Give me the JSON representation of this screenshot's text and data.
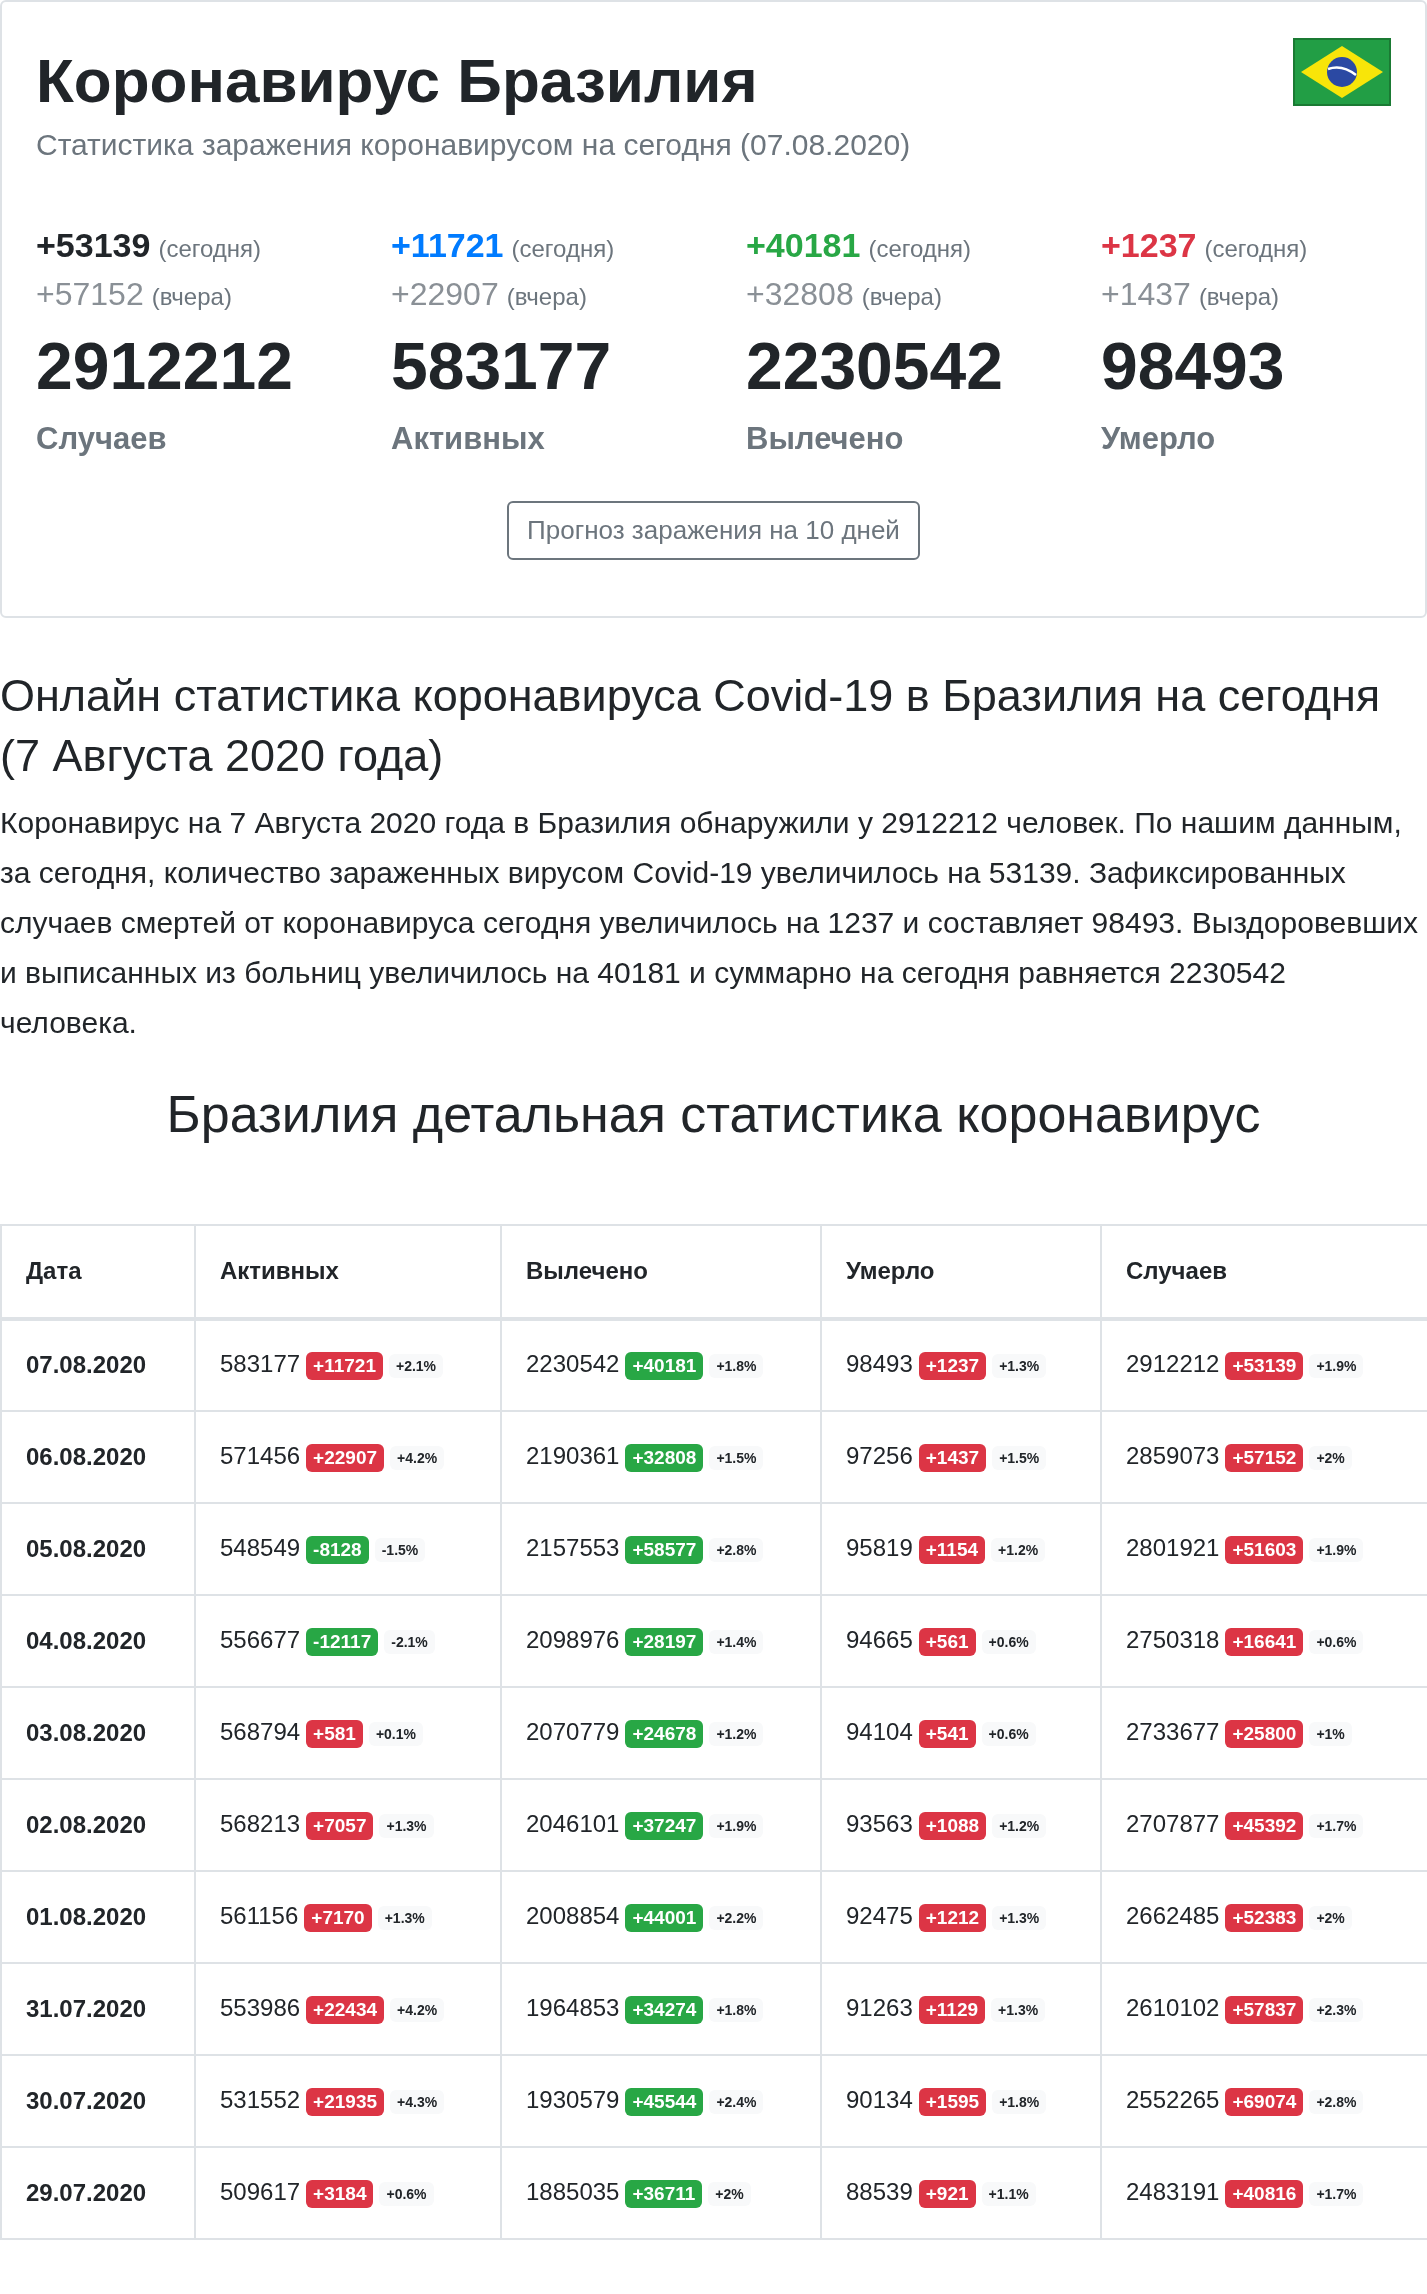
{
  "header": {
    "title": "Коронавирус Бразилия",
    "subtitle": "Статистика заражения коронавирусом на сегодня (07.08.2020)"
  },
  "stats": [
    {
      "today": "+53139",
      "today_label": "(сегодня)",
      "yesterday": "+57152",
      "yesterday_label": "(вчера)",
      "total": "2912212",
      "label": "Случаев",
      "color": "#212529"
    },
    {
      "today": "+11721",
      "today_label": "(сегодня)",
      "yesterday": "+22907",
      "yesterday_label": "(вчера)",
      "total": "583177",
      "label": "Активных",
      "color": "#007bff"
    },
    {
      "today": "+40181",
      "today_label": "(сегодня)",
      "yesterday": "+32808",
      "yesterday_label": "(вчера)",
      "total": "2230542",
      "label": "Вылечено",
      "color": "#28a745"
    },
    {
      "today": "+1237",
      "today_label": "(сегодня)",
      "yesterday": "+1437",
      "yesterday_label": "(вчера)",
      "total": "98493",
      "label": "Умерло",
      "color": "#dc3545"
    }
  ],
  "forecast_button": "Прогноз заражения на 10 дней",
  "article": {
    "heading": "Онлайн статистика коронавируса Covid-19 в Бразилия на сегодня (7 Августа 2020 года)",
    "paragraph": "Коронавирус на 7 Августа 2020 года в Бразилия обнаружили у 2912212 человек. По нашим данным, за сегодня, количество зараженных вирусом Covid-19 увеличилось на 53139. Зафиксированных случаев смертей от коронавируса сегодня увеличилось на 1237 и составляет 98493. Выздоровевших и выписанных из больниц увеличилось на 40181 и суммарно на сегодня равняется 2230542 человека."
  },
  "section_title": "Бразилия детальная статистика коронавирус",
  "table": {
    "columns": [
      "Дата",
      "Активных",
      "Вылечено",
      "Умерло",
      "Случаев"
    ],
    "rows": [
      {
        "cells": [
          {
            "kind": "date",
            "value": "07.08.2020"
          },
          {
            "kind": "stat",
            "value": "583177",
            "change": "+11721",
            "color": "#dc3545",
            "percent": "+2.1%"
          },
          {
            "kind": "stat",
            "value": "2230542",
            "change": "+40181",
            "color": "#28a745",
            "percent": "+1.8%"
          },
          {
            "kind": "stat",
            "value": "98493",
            "change": "+1237",
            "color": "#dc3545",
            "percent": "+1.3%"
          },
          {
            "kind": "stat",
            "value": "2912212",
            "change": "+53139",
            "color": "#dc3545",
            "percent": "+1.9%"
          }
        ]
      },
      {
        "cells": [
          {
            "kind": "date",
            "value": "06.08.2020"
          },
          {
            "kind": "stat",
            "value": "571456",
            "change": "+22907",
            "color": "#dc3545",
            "percent": "+4.2%"
          },
          {
            "kind": "stat",
            "value": "2190361",
            "change": "+32808",
            "color": "#28a745",
            "percent": "+1.5%"
          },
          {
            "kind": "stat",
            "value": "97256",
            "change": "+1437",
            "color": "#dc3545",
            "percent": "+1.5%"
          },
          {
            "kind": "stat",
            "value": "2859073",
            "change": "+57152",
            "color": "#dc3545",
            "percent": "+2%"
          }
        ]
      },
      {
        "cells": [
          {
            "kind": "date",
            "value": "05.08.2020"
          },
          {
            "kind": "stat",
            "value": "548549",
            "change": "-8128",
            "color": "#28a745",
            "percent": "-1.5%"
          },
          {
            "kind": "stat",
            "value": "2157553",
            "change": "+58577",
            "color": "#28a745",
            "percent": "+2.8%"
          },
          {
            "kind": "stat",
            "value": "95819",
            "change": "+1154",
            "color": "#dc3545",
            "percent": "+1.2%"
          },
          {
            "kind": "stat",
            "value": "2801921",
            "change": "+51603",
            "color": "#dc3545",
            "percent": "+1.9%"
          }
        ]
      },
      {
        "cells": [
          {
            "kind": "date",
            "value": "04.08.2020"
          },
          {
            "kind": "stat",
            "value": "556677",
            "change": "-12117",
            "color": "#28a745",
            "percent": "-2.1%"
          },
          {
            "kind": "stat",
            "value": "2098976",
            "change": "+28197",
            "color": "#28a745",
            "percent": "+1.4%"
          },
          {
            "kind": "stat",
            "value": "94665",
            "change": "+561",
            "color": "#dc3545",
            "percent": "+0.6%"
          },
          {
            "kind": "stat",
            "value": "2750318",
            "change": "+16641",
            "color": "#dc3545",
            "percent": "+0.6%"
          }
        ]
      },
      {
        "cells": [
          {
            "kind": "date",
            "value": "03.08.2020"
          },
          {
            "kind": "stat",
            "value": "568794",
            "change": "+581",
            "color": "#dc3545",
            "percent": "+0.1%"
          },
          {
            "kind": "stat",
            "value": "2070779",
            "change": "+24678",
            "color": "#28a745",
            "percent": "+1.2%"
          },
          {
            "kind": "stat",
            "value": "94104",
            "change": "+541",
            "color": "#dc3545",
            "percent": "+0.6%"
          },
          {
            "kind": "stat",
            "value": "2733677",
            "change": "+25800",
            "color": "#dc3545",
            "percent": "+1%"
          }
        ]
      },
      {
        "cells": [
          {
            "kind": "date",
            "value": "02.08.2020"
          },
          {
            "kind": "stat",
            "value": "568213",
            "change": "+7057",
            "color": "#dc3545",
            "percent": "+1.3%"
          },
          {
            "kind": "stat",
            "value": "2046101",
            "change": "+37247",
            "color": "#28a745",
            "percent": "+1.9%"
          },
          {
            "kind": "stat",
            "value": "93563",
            "change": "+1088",
            "color": "#dc3545",
            "percent": "+1.2%"
          },
          {
            "kind": "stat",
            "value": "2707877",
            "change": "+45392",
            "color": "#dc3545",
            "percent": "+1.7%"
          }
        ]
      },
      {
        "cells": [
          {
            "kind": "date",
            "value": "01.08.2020"
          },
          {
            "kind": "stat",
            "value": "561156",
            "change": "+7170",
            "color": "#dc3545",
            "percent": "+1.3%"
          },
          {
            "kind": "stat",
            "value": "2008854",
            "change": "+44001",
            "color": "#28a745",
            "percent": "+2.2%"
          },
          {
            "kind": "stat",
            "value": "92475",
            "change": "+1212",
            "color": "#dc3545",
            "percent": "+1.3%"
          },
          {
            "kind": "stat",
            "value": "2662485",
            "change": "+52383",
            "color": "#dc3545",
            "percent": "+2%"
          }
        ]
      },
      {
        "cells": [
          {
            "kind": "date",
            "value": "31.07.2020"
          },
          {
            "kind": "stat",
            "value": "553986",
            "change": "+22434",
            "color": "#dc3545",
            "percent": "+4.2%"
          },
          {
            "kind": "stat",
            "value": "1964853",
            "change": "+34274",
            "color": "#28a745",
            "percent": "+1.8%"
          },
          {
            "kind": "stat",
            "value": "91263",
            "change": "+1129",
            "color": "#dc3545",
            "percent": "+1.3%"
          },
          {
            "kind": "stat",
            "value": "2610102",
            "change": "+57837",
            "color": "#dc3545",
            "percent": "+2.3%"
          }
        ]
      },
      {
        "cells": [
          {
            "kind": "date",
            "value": "30.07.2020"
          },
          {
            "kind": "stat",
            "value": "531552",
            "change": "+21935",
            "color": "#dc3545",
            "percent": "+4.3%"
          },
          {
            "kind": "stat",
            "value": "1930579",
            "change": "+45544",
            "color": "#28a745",
            "percent": "+2.4%"
          },
          {
            "kind": "stat",
            "value": "90134",
            "change": "+1595",
            "color": "#dc3545",
            "percent": "+1.8%"
          },
          {
            "kind": "stat",
            "value": "2552265",
            "change": "+69074",
            "color": "#dc3545",
            "percent": "+2.8%"
          }
        ]
      },
      {
        "cells": [
          {
            "kind": "date",
            "value": "29.07.2020"
          },
          {
            "kind": "stat",
            "value": "509617",
            "change": "+3184",
            "color": "#dc3545",
            "percent": "+0.6%"
          },
          {
            "kind": "stat",
            "value": "1885035",
            "change": "+36711",
            "color": "#28a745",
            "percent": "+2%"
          },
          {
            "kind": "stat",
            "value": "88539",
            "change": "+921",
            "color": "#dc3545",
            "percent": "+1.1%"
          },
          {
            "kind": "stat",
            "value": "2483191",
            "change": "+40816",
            "color": "#dc3545",
            "percent": "+1.7%"
          }
        ]
      }
    ]
  }
}
